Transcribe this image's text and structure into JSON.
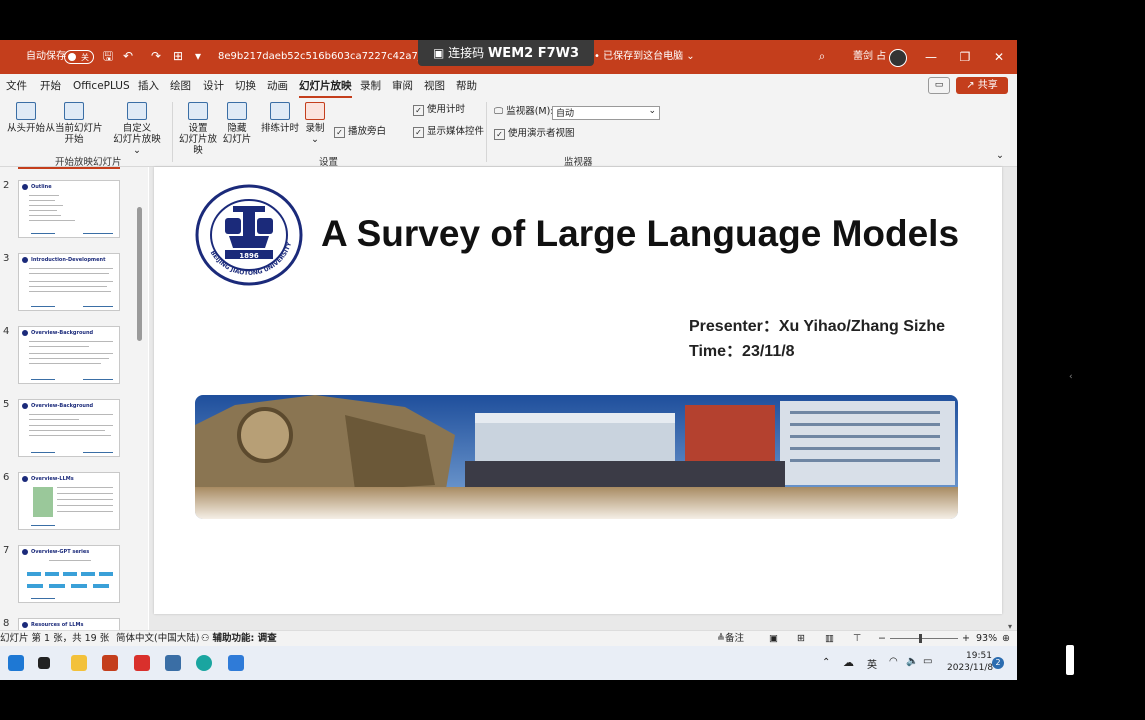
{
  "titlebar": {
    "autosave_label": "自动保存",
    "autosave_state": "关",
    "filename": "8e9b217daeb52c516b603ca7227c42a7_185ca9f7",
    "save_status": "• 已保存到这台电脑 ⌄",
    "user_name": "蕾剑 占"
  },
  "remote_banner": {
    "label": "连接码",
    "code": "WEM2 F7W3"
  },
  "menu": {
    "items": [
      "文件",
      "开始",
      "OfficePLUS",
      "插入",
      "绘图",
      "设计",
      "切换",
      "动画",
      "幻灯片放映",
      "录制",
      "审阅",
      "视图",
      "帮助"
    ],
    "active": "幻灯片放映",
    "share_label": "共享"
  },
  "ribbon": {
    "from_start": "从头开始",
    "from_current_line1": "从当前幻灯片",
    "from_current_line2": "开始",
    "custom_line1": "自定义",
    "custom_line2": "幻灯片放映 ⌄",
    "group_start": "开始放映幻灯片",
    "setup_line1": "设置",
    "setup_line2": "幻灯片放映",
    "hide_line1": "隐藏",
    "hide_line2": "幻灯片",
    "rehearse": "排练计时",
    "record": "录制",
    "record_arrow": "⌄",
    "play_narrations": "播放旁白",
    "use_timings": "使用计时",
    "show_media_controls": "显示媒体控件",
    "group_setup": "设置",
    "monitor_label": "监视器(M):",
    "monitor_value": "自动",
    "presenter_view": "使用演示者视图",
    "group_monitors": "监视器"
  },
  "thumbnails": [
    {
      "num": "2",
      "title": "Outline"
    },
    {
      "num": "3",
      "title": "Introduction-Development"
    },
    {
      "num": "4",
      "title": "Overview-Background"
    },
    {
      "num": "5",
      "title": "Overview-Background"
    },
    {
      "num": "6",
      "title": "Overview-LLMs"
    },
    {
      "num": "7",
      "title": "Overview-GPT series"
    },
    {
      "num": "8",
      "title": "Resources of LLMs"
    }
  ],
  "slide": {
    "title": "A Survey of Large Language Models",
    "presenter": "Presenter：Xu Yihao/Zhang Sizhe",
    "time": "Time：23/11/8",
    "logo_text": "BEIJING JIAOTONG UNIVERSITY",
    "logo_year": "1896"
  },
  "statusbar": {
    "slide_info": "幻灯片 第 1 张，共 19 张",
    "language": "简体中文(中国大陆)",
    "accessibility": "辅助功能: 调查",
    "notes": "备注",
    "zoom_minus": "−",
    "zoom_plus": "+",
    "zoom": "93%"
  },
  "taskbar": {
    "ime": "英",
    "time": "19:51",
    "date": "2023/11/8",
    "notifications": "2"
  },
  "colors": {
    "accent": "#c43e1c",
    "navy": "#1b2a7a"
  }
}
